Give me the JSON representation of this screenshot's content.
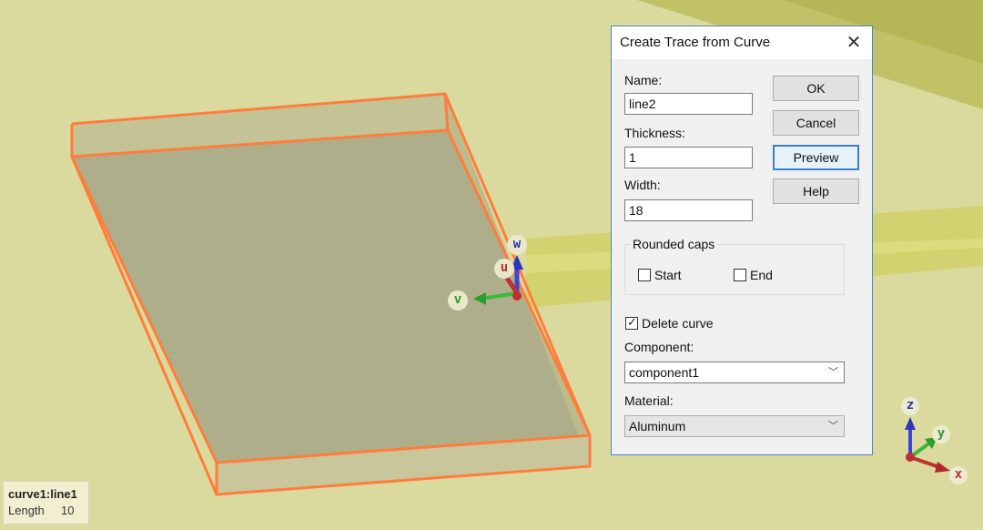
{
  "dialog": {
    "title": "Create Trace from Curve",
    "name_label": "Name:",
    "name_value": "line2",
    "thickness_label": "Thickness:",
    "thickness_value": "1",
    "width_label": "Width:",
    "width_value": "18",
    "rounded_caps_label": "Rounded caps",
    "start_label": "Start",
    "start_checked": false,
    "end_label": "End",
    "end_checked": false,
    "delete_curve_label": "Delete curve",
    "delete_curve_checked": true,
    "component_label": "Component:",
    "component_value": "component1",
    "material_label": "Material:",
    "material_value": "Aluminum",
    "buttons": {
      "ok": "OK",
      "cancel": "Cancel",
      "preview": "Preview",
      "help": "Help"
    }
  },
  "gizmo": {
    "u": "u",
    "v": "v",
    "w": "w"
  },
  "axes": {
    "x": "x",
    "y": "y",
    "z": "z"
  },
  "info": {
    "object": "curve1:line1",
    "length_label": "Length",
    "length_value": "10"
  },
  "colors": {
    "background": "#dad99e",
    "trace_highlight": "#ff7d3c",
    "accent": "#3c7fc4"
  }
}
